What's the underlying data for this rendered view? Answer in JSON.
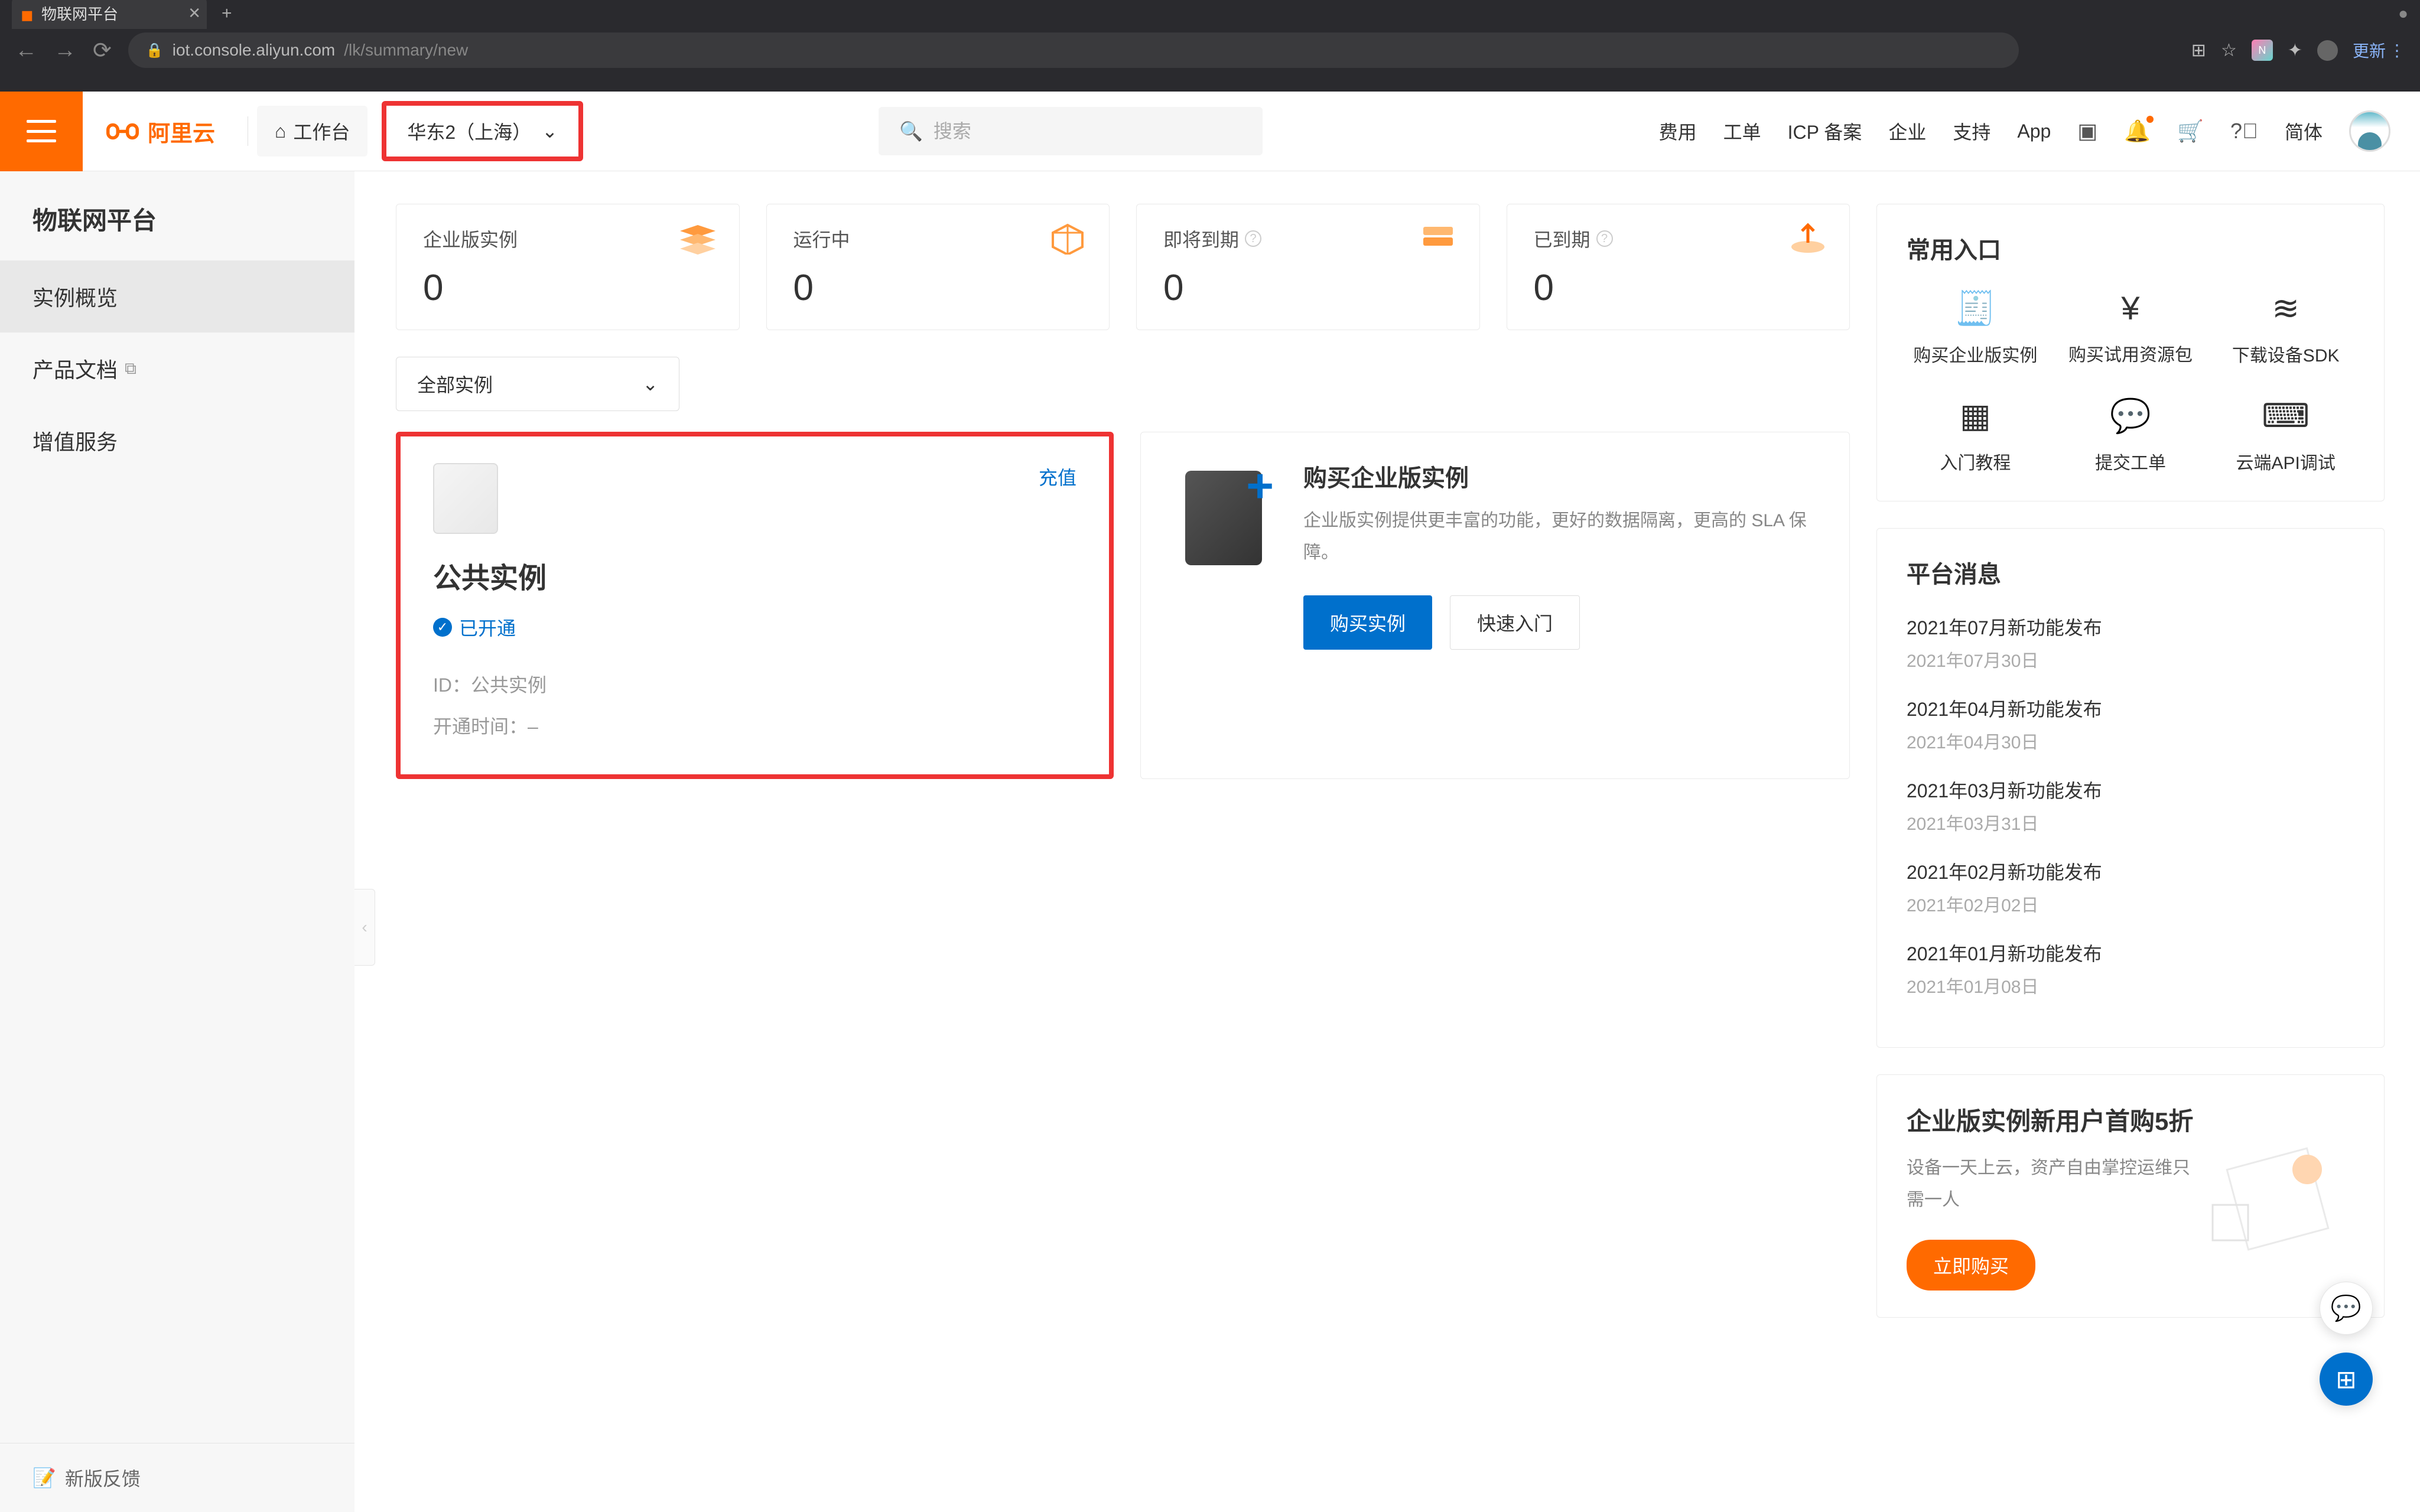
{
  "browser": {
    "tab_title": "物联网平台",
    "url_host": "iot.console.aliyun.com",
    "url_path": "/lk/summary/new",
    "update_label": "更新"
  },
  "header": {
    "logo_text": "阿里云",
    "workspace": "工作台",
    "region": "华东2（上海）",
    "search_placeholder": "搜索",
    "nav": {
      "fee": "费用",
      "order": "工单",
      "icp": "ICP 备案",
      "enterprise": "企业",
      "support": "支持",
      "app": "App",
      "lang": "简体"
    }
  },
  "sidebar": {
    "title": "物联网平台",
    "items": [
      "实例概览",
      "产品文档",
      "增值服务"
    ],
    "footer": "新版反馈"
  },
  "stats": {
    "enterprise": {
      "label": "企业版实例",
      "value": "0"
    },
    "running": {
      "label": "运行中",
      "value": "0"
    },
    "expiring": {
      "label": "即将到期",
      "value": "0"
    },
    "expired": {
      "label": "已到期",
      "value": "0"
    }
  },
  "filter": {
    "all_instances": "全部实例"
  },
  "public_instance": {
    "recharge": "充值",
    "title": "公共实例",
    "status": "已开通",
    "id_label": "ID：",
    "id_value": "公共实例",
    "time_label": "开通时间：",
    "time_value": "–"
  },
  "enterprise_promo": {
    "title": "购买企业版实例",
    "desc": "企业版实例提供更丰富的功能，更好的数据隔离，更高的 SLA 保障。",
    "buy_btn": "购买实例",
    "quick_btn": "快速入门"
  },
  "quick_links": {
    "title": "常用入口",
    "items": [
      "购买企业版实例",
      "购买试用资源包",
      "下载设备SDK",
      "入门教程",
      "提交工单",
      "云端API调试"
    ]
  },
  "news": {
    "title": "平台消息",
    "items": [
      {
        "title": "2021年07月新功能发布",
        "date": "2021年07月30日"
      },
      {
        "title": "2021年04月新功能发布",
        "date": "2021年04月30日"
      },
      {
        "title": "2021年03月新功能发布",
        "date": "2021年03月31日"
      },
      {
        "title": "2021年02月新功能发布",
        "date": "2021年02月02日"
      },
      {
        "title": "2021年01月新功能发布",
        "date": "2021年01月08日"
      }
    ]
  },
  "banner": {
    "title": "企业版实例新用户首购5折",
    "desc": "设备一天上云，资产自由掌控运维只需一人",
    "btn": "立即购买"
  }
}
